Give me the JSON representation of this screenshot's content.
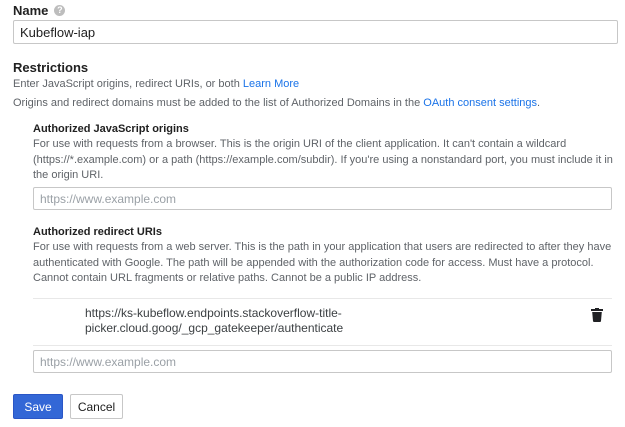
{
  "name": {
    "label": "Name",
    "value": "Kubeflow-iap"
  },
  "restrictions": {
    "title": "Restrictions",
    "intro_text": "Enter JavaScript origins, redirect URIs, or both ",
    "learn_more": "Learn More",
    "domains_text": "Origins and redirect domains must be added to the list of Authorized Domains in the ",
    "consent_link": "OAuth consent settings",
    "domains_suffix": "."
  },
  "js_origins": {
    "title": "Authorized JavaScript origins",
    "description": "For use with requests from a browser. This is the origin URI of the client application. It can't contain a wildcard (https://*.example.com) or a path (https://example.com/subdir). If you're using a nonstandard port, you must include it in the origin URI.",
    "placeholder": "https://www.example.com"
  },
  "redirect_uris": {
    "title": "Authorized redirect URIs",
    "description": "For use with requests from a web server. This is the path in your application that users are redirected to after they have authenticated with Google. The path will be appended with the authorization code for access. Must have a protocol. Cannot contain URL fragments or relative paths. Cannot be a public IP address.",
    "entries": [
      "https://ks-kubeflow.endpoints.stackoverflow-title-picker.cloud.goog/_gcp_gatekeeper/authenticate"
    ],
    "placeholder": "https://www.example.com"
  },
  "actions": {
    "save_label": "Save",
    "cancel_label": "Cancel"
  },
  "icons": {
    "help": "help-icon",
    "delete": "trash-icon"
  },
  "colors": {
    "link": "#1a73e8",
    "primary_button": "#3367d6"
  }
}
